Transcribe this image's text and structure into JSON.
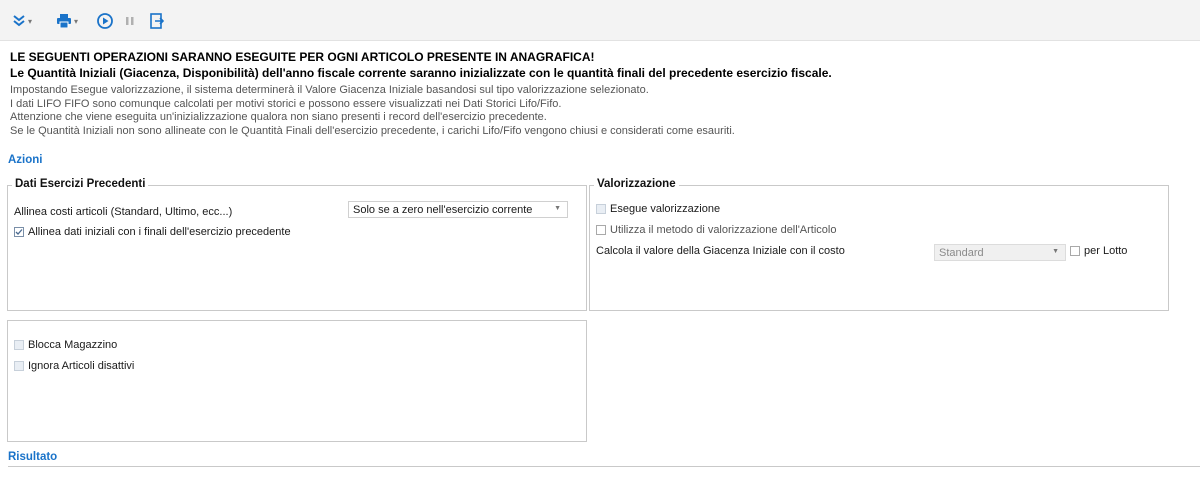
{
  "toolbar": {
    "items": [
      {
        "icon": "expand-double-chevron-icon",
        "has_dropdown": true
      },
      {
        "icon": "printer-icon",
        "has_dropdown": true
      },
      {
        "icon": "play-circle-icon",
        "has_dropdown": false
      },
      {
        "icon": "pause-icon",
        "has_dropdown": false
      },
      {
        "icon": "exit-icon",
        "has_dropdown": false
      }
    ],
    "accent": "#1a73c9"
  },
  "header": {
    "title": "LE SEGUENTI OPERAZIONI SARANNO ESEGUITE PER OGNI ARTICOLO PRESENTE IN ANAGRAFICA!",
    "subtitle": "Le Quantità Iniziali (Giacenza, Disponibilità) dell'anno fiscale corrente saranno inizializzate con le quantità finali del precedente esercizio fiscale.",
    "notes": [
      "Impostando Esegue valorizzazione, il sistema determinerà il Valore Giacenza Iniziale basandosi sul tipo valorizzazione selezionato.",
      "I dati LIFO FIFO sono comunque calcolati per motivi storici e possono essere visualizzati nei Dati Storici Lifo/Fifo.",
      "Attenzione che viene eseguita un'inizializzazione qualora non siano presenti i record dell'esercizio precedente.",
      "Se le Quantità Iniziali non sono allineate con le Quantità Finali dell'esercizio precedente, i carichi Lifo/Fifo vengono chiusi e considerati come esauriti."
    ]
  },
  "sections": {
    "azioni": "Azioni",
    "risultato": "Risultato"
  },
  "dati_esercizi": {
    "legend": "Dati Esercizi Precedenti",
    "costi_label": "Allinea costi articoli (Standard, Ultimo, ecc...)",
    "costi_value": "Solo se a zero nell'esercizio corrente",
    "allinea_label": "Allinea dati iniziali con i finali dell'esercizio precedente",
    "allinea_checked": true
  },
  "valorizzazione": {
    "legend": "Valorizzazione",
    "esegue_label": "Esegue valorizzazione",
    "esegue_checked": false,
    "utilizza_label": "Utilizza il metodo di valorizzazione dell'Articolo",
    "utilizza_checked": false,
    "calcola_label": "Calcola il valore della Giacenza Iniziale con il costo",
    "calcola_value": "Standard",
    "per_lotto_label": "per Lotto",
    "per_lotto_checked": false
  },
  "magazzino": {
    "blocca_label": "Blocca Magazzino",
    "blocca_checked": false,
    "ignora_label": "Ignora Articoli disattivi",
    "ignora_checked": false
  }
}
